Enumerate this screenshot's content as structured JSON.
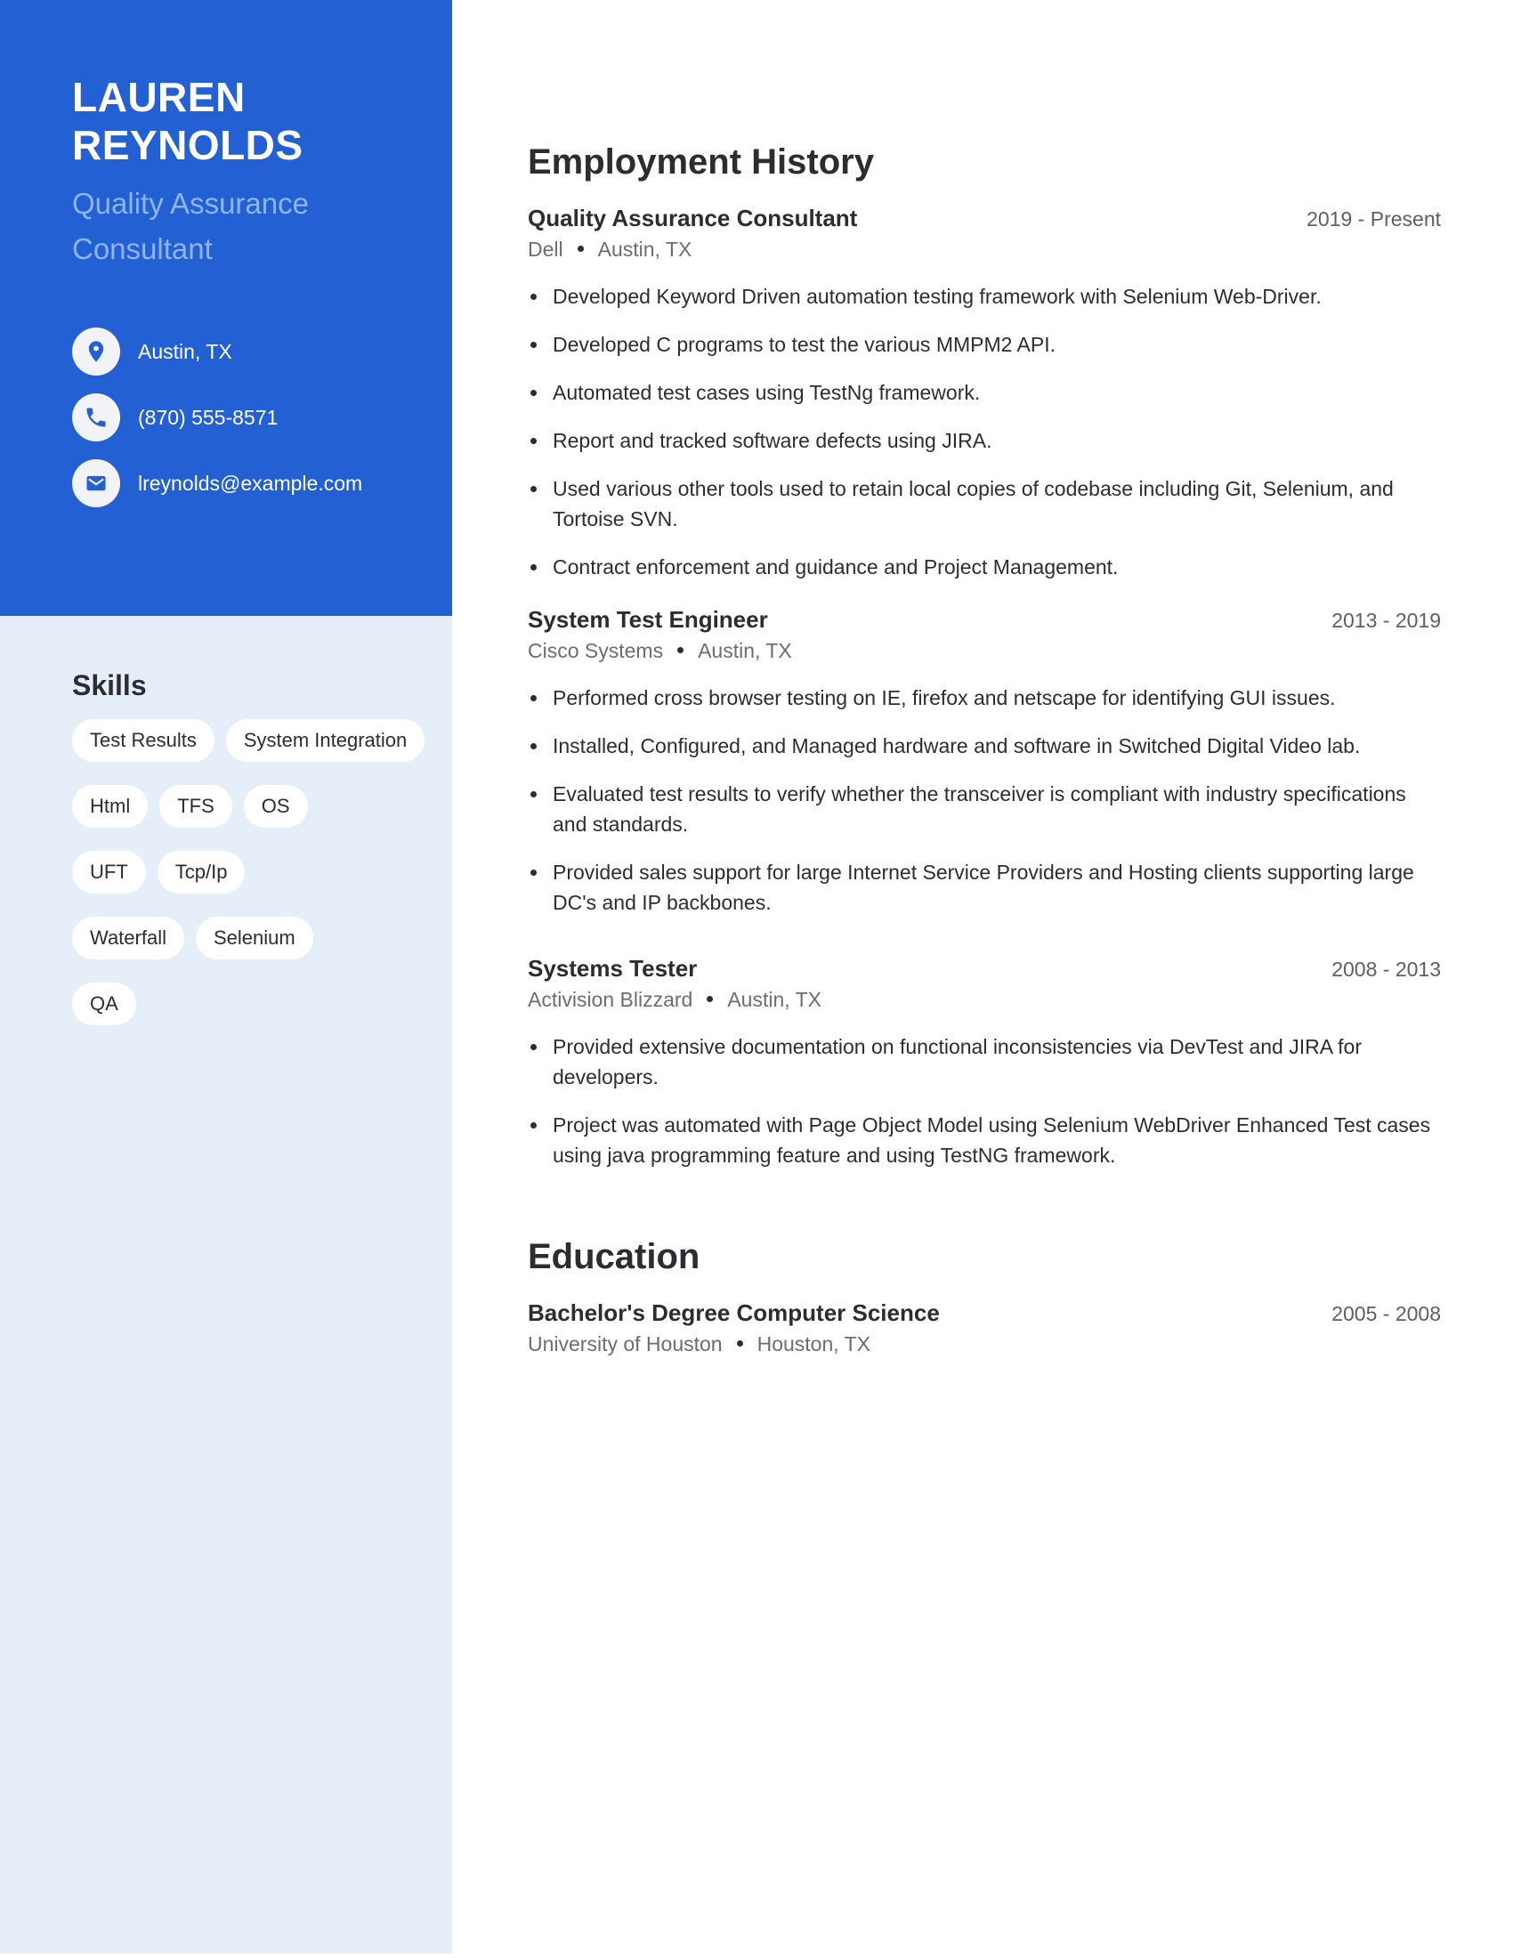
{
  "profile": {
    "first_name": "LAUREN",
    "last_name": "REYNOLDS",
    "title_line1": "Quality Assurance",
    "title_line2": "Consultant"
  },
  "contacts": [
    {
      "icon": "location-pin-icon",
      "text": "Austin, TX"
    },
    {
      "icon": "phone-icon",
      "text": "(870) 555-8571"
    },
    {
      "icon": "envelope-icon",
      "text": "lreynolds@example.com"
    }
  ],
  "skills": {
    "title": "Skills",
    "items": [
      "Test Results",
      "System Integration",
      "Html",
      "TFS",
      "OS",
      "UFT",
      "Tcp/Ip",
      "Waterfall",
      "Selenium",
      "QA"
    ]
  },
  "employment": {
    "title": "Employment History",
    "jobs": [
      {
        "title": "Quality Assurance Consultant",
        "dates": "2019 - Present",
        "company": "Dell",
        "location": "Austin, TX",
        "bullets": [
          "Developed Keyword Driven automation testing framework with Selenium Web-Driver.",
          "Developed C programs to test the various MMPM2 API.",
          "Automated test cases using TestNg framework.",
          "Report and tracked software defects using JIRA.",
          "Used various other tools used to retain local copies of codebase including Git, Selenium, and Tortoise SVN.",
          "Contract enforcement and guidance and Project Management."
        ]
      },
      {
        "title": "System Test Engineer",
        "dates": "2013 - 2019",
        "company": "Cisco Systems",
        "location": "Austin, TX",
        "bullets": [
          "Performed cross browser testing on IE, firefox and netscape for identifying GUI issues.",
          "Installed, Configured, and Managed hardware and software in Switched Digital Video lab.",
          "Evaluated test results to verify whether the transceiver is compliant with industry specifications and standards.",
          "Provided sales support for large Internet Service Providers and Hosting clients supporting large DC's and IP backbones."
        ]
      },
      {
        "title": "Systems Tester",
        "dates": "2008 - 2013",
        "company": "Activision Blizzard",
        "location": "Austin, TX",
        "bullets": [
          "Provided extensive documentation on functional inconsistencies via DevTest and JIRA for developers.",
          "Project was automated with Page Object Model using Selenium WebDriver Enhanced Test cases using java programming feature and using TestNG framework."
        ]
      }
    ]
  },
  "education": {
    "title": "Education",
    "entries": [
      {
        "degree": "Bachelor's Degree Computer Science",
        "dates": "2005 - 2008",
        "school": "University of Houston",
        "location": "Houston, TX"
      }
    ]
  },
  "colors": {
    "accent": "#2260d4",
    "sidebar_light": "#e6eefa",
    "subtitle": "#8fb4f0",
    "text": "#2b2d31",
    "muted": "#6a6d73"
  }
}
